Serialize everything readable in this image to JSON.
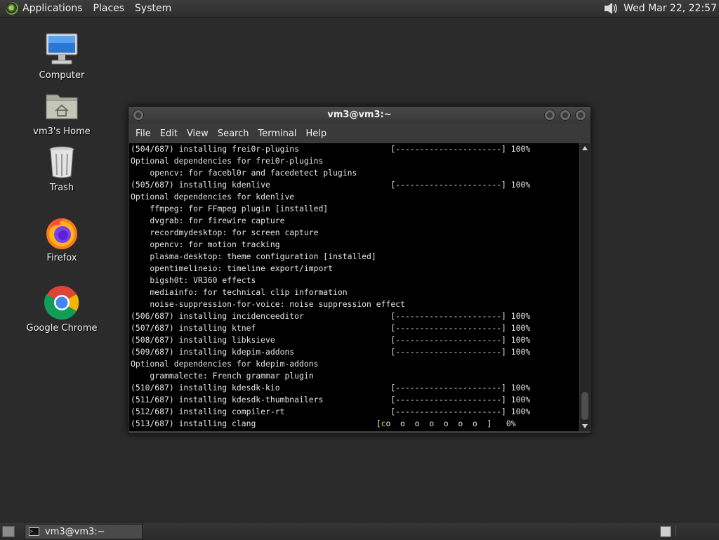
{
  "top_panel": {
    "menus": [
      "Applications",
      "Places",
      "System"
    ],
    "clock": "Wed Mar 22, 22:57",
    "icons": {
      "logo": "mate-logo-icon",
      "volume": "speaker-icon"
    }
  },
  "desktop": {
    "icons": [
      {
        "label": "Computer",
        "icon": "computer-icon"
      },
      {
        "label": "vm3's Home",
        "icon": "home-folder-icon"
      },
      {
        "label": "Trash",
        "icon": "trash-icon"
      },
      {
        "label": "Firefox",
        "icon": "firefox-icon"
      },
      {
        "label": "Google Chrome",
        "icon": "chrome-icon"
      }
    ]
  },
  "terminal": {
    "title": "vm3@vm3:~",
    "menus": [
      "File",
      "Edit",
      "View",
      "Search",
      "Terminal",
      "Help"
    ],
    "lines": [
      "(504/687) installing frei0r-plugins                   [----------------------] 100%",
      "Optional dependencies for frei0r-plugins",
      "    opencv: for facebl0r and facedetect plugins",
      "(505/687) installing kdenlive                         [----------------------] 100%",
      "Optional dependencies for kdenlive",
      "    ffmpeg: for FFmpeg plugin [installed]",
      "    dvgrab: for firewire capture",
      "    recordmydesktop: for screen capture",
      "    opencv: for motion tracking",
      "    plasma-desktop: theme configuration [installed]",
      "    opentimelineio: timeline export/import",
      "    bigsh0t: VR360 effects",
      "    mediainfo: for technical clip information",
      "    noise-suppression-for-voice: noise suppression effect",
      "(506/687) installing incidenceeditor                  [----------------------] 100%",
      "(507/687) installing ktnef                            [----------------------] 100%",
      "(508/687) installing libksieve                        [----------------------] 100%",
      "(509/687) installing kdepim-addons                    [----------------------] 100%",
      "Optional dependencies for kdepim-addons",
      "    grammalecte: French grammar plugin",
      "(510/687) installing kdesdk-kio                       [----------------------] 100%",
      "(511/687) installing kdesdk-thumbnailers              [----------------------] 100%",
      "(512/687) installing compiler-rt                      [----------------------] 100%"
    ],
    "last_line": {
      "prefix": "(513/687) installing clang                         [",
      "pacman": "c",
      "suffix": "o  o  o  o  o  o  o  ]   0%"
    }
  },
  "bottom_panel": {
    "task_label": "vm3@vm3:~",
    "task_icon": "terminal-icon",
    "show_desktop_icon": "show-desktop-icon"
  },
  "colors": {
    "desktop_bg": "#2b2b2b",
    "terminal_bg": "#000000",
    "terminal_fg": "#e6e6e6",
    "pacman_yellow": "#ffd23c"
  }
}
